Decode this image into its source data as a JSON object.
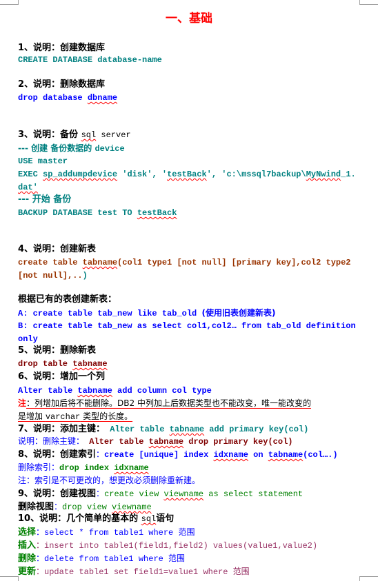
{
  "title": "一、基础",
  "sections": {
    "s1": {
      "heading": "1、说明：创建数据库",
      "code": "CREATE DATABASE database-name"
    },
    "s2": {
      "heading": "2、说明：删除数据库",
      "code_a": "drop database ",
      "code_b": "dbname"
    },
    "s3": {
      "heading_a": "3、说明：备份 ",
      "heading_b": "sql",
      "heading_c": " server",
      "comment1_a": "--- 创建 备份数据的 ",
      "comment1_b": "device",
      "use": "USE master",
      "exec_a": "EXEC ",
      "exec_b": "sp_addumpdevice",
      "exec_c": " 'disk', '",
      "exec_d": "testBack",
      "exec_e": "', 'c:\\mssql7backup\\",
      "exec_f": "MyNwind",
      "exec_g": "_1.",
      "exec_h": "dat'",
      "comment2": "--- 开始 备份",
      "backup_a": "BACKUP DATABASE test TO ",
      "backup_b": "testBack"
    },
    "s4": {
      "heading": "4、说明：创建新表",
      "code1_a": "create table ",
      "code1_b": "tabname",
      "code1_c": "(col1 type1 [not null] [primary key],col2 type2",
      "code2_a": "[not null],..",
      "code2_b": ")"
    },
    "based": {
      "heading": "根据已有的表创建新表：",
      "a_code": "A: create table tab_new like tab_old ",
      "a_note": "(使用旧表创建新表)",
      "b_code": "B: create table tab_new as select col1,col2… from tab_old definition",
      "b_cont": " only"
    },
    "s5": {
      "heading": "5、说明：删除新表",
      "code_a": "drop table ",
      "code_b": "tabname"
    },
    "s6": {
      "heading": "6、说明：增加一个列",
      "code_a": "Alter table ",
      "code_b": "tabname",
      "code_c": " add column col type",
      "note_label": "注",
      "note1": "：列增加后将不能删除。DB2 中列加上后数据类型也不能改变，唯一能改变的",
      "note2_a": "是增加 ",
      "note2_b": "varchar",
      "note2_c": " 类型的长度。"
    },
    "s7": {
      "heading": "7、说明：添加主键：",
      "code_a": " Alter table ",
      "code_b": "tabname",
      "code_c": " add primary key(col)",
      "drop_label": "说明：删除主键：",
      "drop_a": " Alter table ",
      "drop_b": "tabname",
      "drop_c": " drop primary key(col)"
    },
    "s8": {
      "heading": "8、说明：创建索引",
      "colon": "：",
      "code_a": "create [unique] index ",
      "code_b": "idxname",
      "code_c": " on ",
      "code_d": "tabname",
      "code_e": "(col….)",
      "drop_label": "删除索引：",
      "drop_a": "drop index ",
      "drop_b": "idxname",
      "note": "注：索引是不可更改的，想更改必须删除重新建。"
    },
    "s9": {
      "heading": "9、说明：创建视图",
      "colon": "：",
      "code_a": "create view ",
      "code_b": "viewname",
      "code_c": " as select statement",
      "drop_label": "删除视图",
      "drop_colon": "：",
      "drop_a": "drop view ",
      "drop_b": "viewname"
    },
    "s10": {
      "heading_a": "10、说明：几个简单的基本的 ",
      "heading_b": "sql",
      "heading_c": "语句",
      "select_label": "选择",
      "select_code": "：select * from table1 where 范围",
      "insert_label": "插入",
      "insert_code": "：insert into table1(field1,field2) values(value1,value2)",
      "delete_label": "删除",
      "delete_code": "：delete from table1 where 范围",
      "update_label": "更新",
      "update_code": "：update table1 set field1=value1 where 范围"
    }
  }
}
